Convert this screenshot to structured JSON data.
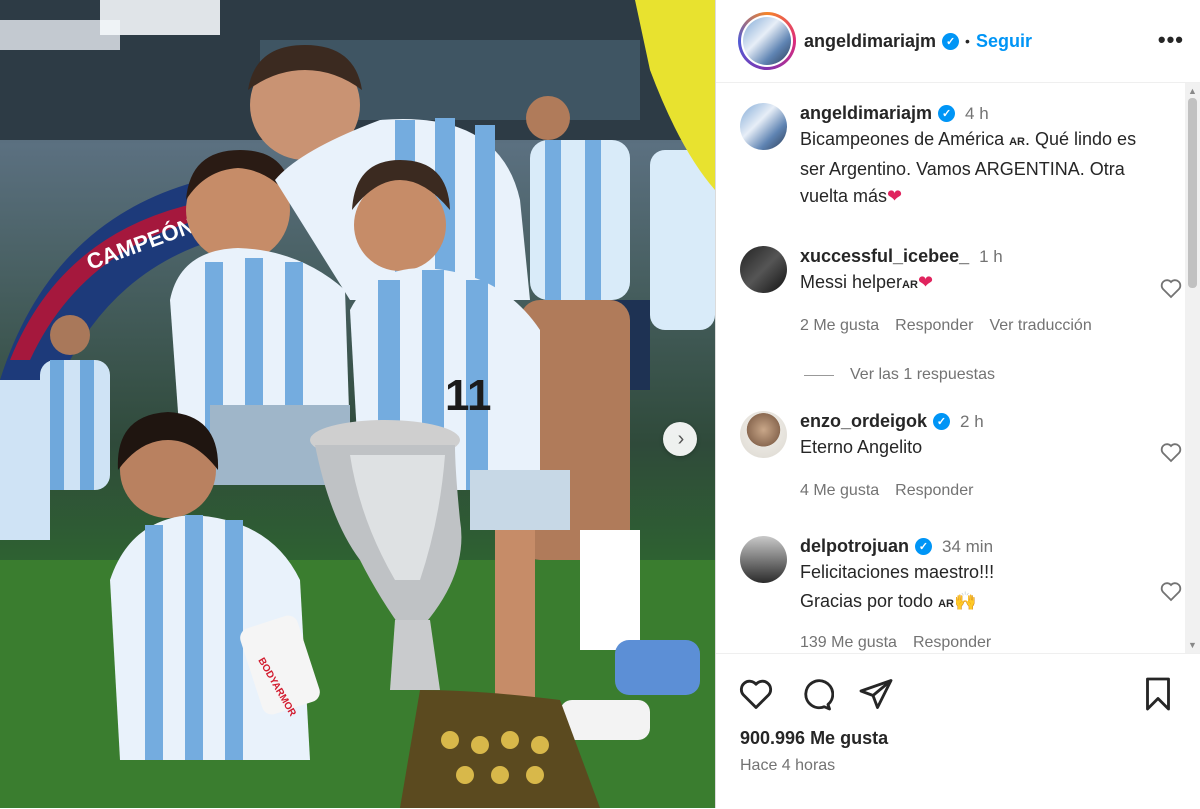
{
  "header": {
    "username": "angeldimariajm",
    "dot": "•",
    "follow_label": "Seguir",
    "more_label": "•••"
  },
  "caption": {
    "username": "angeldimariajm",
    "time": "4 h",
    "text_parts": [
      "Bicampeones de América ",
      "AR",
      ". Qué lindo es ser Argentino. Vamos ARGENTINA. Otra vuelta más",
      "❤"
    ]
  },
  "comments": [
    {
      "username": "xuccessful_icebee_",
      "verified": false,
      "time": "1 h",
      "text": "Messi helper",
      "flag": "AR",
      "emoji": "❤",
      "likes": "2 Me gusta",
      "reply_label": "Responder",
      "translate_label": "Ver traducción",
      "view_replies": "Ver las 1 respuestas"
    },
    {
      "username": "enzo_ordeigok",
      "verified": true,
      "time": "2 h",
      "text": "Eterno Angelito",
      "likes": "4 Me gusta",
      "reply_label": "Responder"
    },
    {
      "username": "delpotrojuan",
      "verified": true,
      "time": "34 min",
      "text_line1": "Felicitaciones maestro!!!",
      "text_line2": "Gracias por todo ",
      "flag": "AR",
      "emoji": "🙌",
      "likes": "139 Me gusta",
      "reply_label": "Responder"
    }
  ],
  "footer": {
    "likes": "900.996 Me gusta",
    "time_ago": "Hace 4 horas"
  },
  "media": {
    "jersey_number": "11",
    "banner_text": "CAMPEÓN",
    "bottle_text": "BODYARMOR"
  }
}
